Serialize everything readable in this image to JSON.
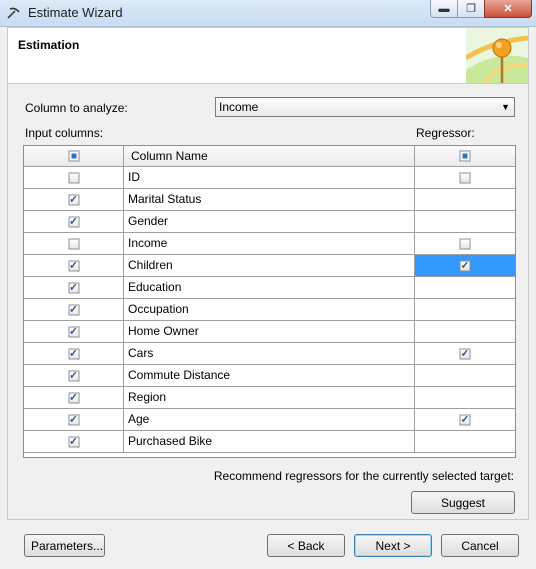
{
  "window": {
    "title": "Estimate Wizard"
  },
  "header": {
    "title": "Estimation"
  },
  "form": {
    "column_to_analyze_label": "Column to analyze:",
    "column_to_analyze_value": "Income",
    "input_columns_label": "Input columns:",
    "regressor_label": "Regressor:"
  },
  "grid": {
    "column_header": "Column Name",
    "rows": [
      {
        "name": "ID",
        "input": false,
        "regressor": false,
        "has_regressor_box": true
      },
      {
        "name": "Marital Status",
        "input": true,
        "regressor": false,
        "has_regressor_box": false
      },
      {
        "name": "Gender",
        "input": true,
        "regressor": false,
        "has_regressor_box": false
      },
      {
        "name": "Income",
        "input": false,
        "regressor": false,
        "has_regressor_box": true
      },
      {
        "name": "Children",
        "input": true,
        "regressor": true,
        "has_regressor_box": true,
        "selected": true
      },
      {
        "name": "Education",
        "input": true,
        "regressor": false,
        "has_regressor_box": false
      },
      {
        "name": "Occupation",
        "input": true,
        "regressor": false,
        "has_regressor_box": false
      },
      {
        "name": "Home Owner",
        "input": true,
        "regressor": false,
        "has_regressor_box": false
      },
      {
        "name": "Cars",
        "input": true,
        "regressor": true,
        "has_regressor_box": true
      },
      {
        "name": "Commute Distance",
        "input": true,
        "regressor": false,
        "has_regressor_box": false
      },
      {
        "name": "Region",
        "input": true,
        "regressor": false,
        "has_regressor_box": false
      },
      {
        "name": "Age",
        "input": true,
        "regressor": true,
        "has_regressor_box": true
      },
      {
        "name": "Purchased Bike",
        "input": true,
        "regressor": false,
        "has_regressor_box": false
      }
    ]
  },
  "recommend_text": "Recommend regressors for the currently selected target:",
  "buttons": {
    "suggest": "Suggest",
    "parameters": "Parameters...",
    "back": "< Back",
    "next": "Next >",
    "cancel": "Cancel"
  },
  "colors": {
    "selection": "#3399ff",
    "checkmark": "#1d4f91"
  }
}
